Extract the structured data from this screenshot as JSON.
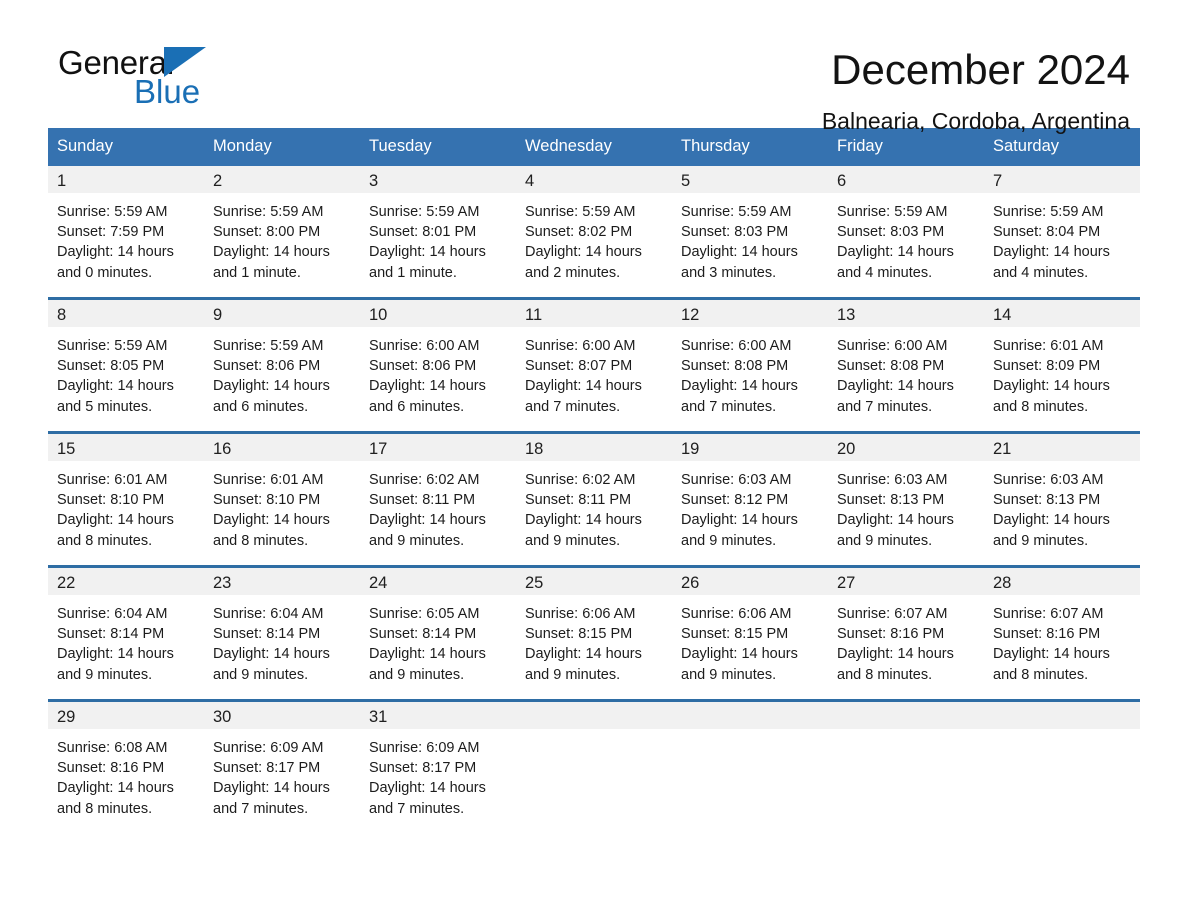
{
  "brand": {
    "name_part1": "General",
    "name_part2": "Blue",
    "triangle_color": "#1a6fb5"
  },
  "header": {
    "title": "December 2024",
    "location": "Balnearia, Cordoba, Argentina"
  },
  "theme": {
    "header_blue": "#3572b0",
    "row_rule_blue": "#2e6da4",
    "daynum_band": "#f1f1f1"
  },
  "weekdays": [
    "Sunday",
    "Monday",
    "Tuesday",
    "Wednesday",
    "Thursday",
    "Friday",
    "Saturday"
  ],
  "labels": {
    "sunrise_prefix": "Sunrise:",
    "sunset_prefix": "Sunset:",
    "daylight_prefix": "Daylight:"
  },
  "weeks": [
    [
      {
        "day": "1",
        "sunrise": "Sunrise: 5:59 AM",
        "sunset": "Sunset: 7:59 PM",
        "daylight_line1": "Daylight: 14 hours",
        "daylight_line2": "and 0 minutes."
      },
      {
        "day": "2",
        "sunrise": "Sunrise: 5:59 AM",
        "sunset": "Sunset: 8:00 PM",
        "daylight_line1": "Daylight: 14 hours",
        "daylight_line2": "and 1 minute."
      },
      {
        "day": "3",
        "sunrise": "Sunrise: 5:59 AM",
        "sunset": "Sunset: 8:01 PM",
        "daylight_line1": "Daylight: 14 hours",
        "daylight_line2": "and 1 minute."
      },
      {
        "day": "4",
        "sunrise": "Sunrise: 5:59 AM",
        "sunset": "Sunset: 8:02 PM",
        "daylight_line1": "Daylight: 14 hours",
        "daylight_line2": "and 2 minutes."
      },
      {
        "day": "5",
        "sunrise": "Sunrise: 5:59 AM",
        "sunset": "Sunset: 8:03 PM",
        "daylight_line1": "Daylight: 14 hours",
        "daylight_line2": "and 3 minutes."
      },
      {
        "day": "6",
        "sunrise": "Sunrise: 5:59 AM",
        "sunset": "Sunset: 8:03 PM",
        "daylight_line1": "Daylight: 14 hours",
        "daylight_line2": "and 4 minutes."
      },
      {
        "day": "7",
        "sunrise": "Sunrise: 5:59 AM",
        "sunset": "Sunset: 8:04 PM",
        "daylight_line1": "Daylight: 14 hours",
        "daylight_line2": "and 4 minutes."
      }
    ],
    [
      {
        "day": "8",
        "sunrise": "Sunrise: 5:59 AM",
        "sunset": "Sunset: 8:05 PM",
        "daylight_line1": "Daylight: 14 hours",
        "daylight_line2": "and 5 minutes."
      },
      {
        "day": "9",
        "sunrise": "Sunrise: 5:59 AM",
        "sunset": "Sunset: 8:06 PM",
        "daylight_line1": "Daylight: 14 hours",
        "daylight_line2": "and 6 minutes."
      },
      {
        "day": "10",
        "sunrise": "Sunrise: 6:00 AM",
        "sunset": "Sunset: 8:06 PM",
        "daylight_line1": "Daylight: 14 hours",
        "daylight_line2": "and 6 minutes."
      },
      {
        "day": "11",
        "sunrise": "Sunrise: 6:00 AM",
        "sunset": "Sunset: 8:07 PM",
        "daylight_line1": "Daylight: 14 hours",
        "daylight_line2": "and 7 minutes."
      },
      {
        "day": "12",
        "sunrise": "Sunrise: 6:00 AM",
        "sunset": "Sunset: 8:08 PM",
        "daylight_line1": "Daylight: 14 hours",
        "daylight_line2": "and 7 minutes."
      },
      {
        "day": "13",
        "sunrise": "Sunrise: 6:00 AM",
        "sunset": "Sunset: 8:08 PM",
        "daylight_line1": "Daylight: 14 hours",
        "daylight_line2": "and 7 minutes."
      },
      {
        "day": "14",
        "sunrise": "Sunrise: 6:01 AM",
        "sunset": "Sunset: 8:09 PM",
        "daylight_line1": "Daylight: 14 hours",
        "daylight_line2": "and 8 minutes."
      }
    ],
    [
      {
        "day": "15",
        "sunrise": "Sunrise: 6:01 AM",
        "sunset": "Sunset: 8:10 PM",
        "daylight_line1": "Daylight: 14 hours",
        "daylight_line2": "and 8 minutes."
      },
      {
        "day": "16",
        "sunrise": "Sunrise: 6:01 AM",
        "sunset": "Sunset: 8:10 PM",
        "daylight_line1": "Daylight: 14 hours",
        "daylight_line2": "and 8 minutes."
      },
      {
        "day": "17",
        "sunrise": "Sunrise: 6:02 AM",
        "sunset": "Sunset: 8:11 PM",
        "daylight_line1": "Daylight: 14 hours",
        "daylight_line2": "and 9 minutes."
      },
      {
        "day": "18",
        "sunrise": "Sunrise: 6:02 AM",
        "sunset": "Sunset: 8:11 PM",
        "daylight_line1": "Daylight: 14 hours",
        "daylight_line2": "and 9 minutes."
      },
      {
        "day": "19",
        "sunrise": "Sunrise: 6:03 AM",
        "sunset": "Sunset: 8:12 PM",
        "daylight_line1": "Daylight: 14 hours",
        "daylight_line2": "and 9 minutes."
      },
      {
        "day": "20",
        "sunrise": "Sunrise: 6:03 AM",
        "sunset": "Sunset: 8:13 PM",
        "daylight_line1": "Daylight: 14 hours",
        "daylight_line2": "and 9 minutes."
      },
      {
        "day": "21",
        "sunrise": "Sunrise: 6:03 AM",
        "sunset": "Sunset: 8:13 PM",
        "daylight_line1": "Daylight: 14 hours",
        "daylight_line2": "and 9 minutes."
      }
    ],
    [
      {
        "day": "22",
        "sunrise": "Sunrise: 6:04 AM",
        "sunset": "Sunset: 8:14 PM",
        "daylight_line1": "Daylight: 14 hours",
        "daylight_line2": "and 9 minutes."
      },
      {
        "day": "23",
        "sunrise": "Sunrise: 6:04 AM",
        "sunset": "Sunset: 8:14 PM",
        "daylight_line1": "Daylight: 14 hours",
        "daylight_line2": "and 9 minutes."
      },
      {
        "day": "24",
        "sunrise": "Sunrise: 6:05 AM",
        "sunset": "Sunset: 8:14 PM",
        "daylight_line1": "Daylight: 14 hours",
        "daylight_line2": "and 9 minutes."
      },
      {
        "day": "25",
        "sunrise": "Sunrise: 6:06 AM",
        "sunset": "Sunset: 8:15 PM",
        "daylight_line1": "Daylight: 14 hours",
        "daylight_line2": "and 9 minutes."
      },
      {
        "day": "26",
        "sunrise": "Sunrise: 6:06 AM",
        "sunset": "Sunset: 8:15 PM",
        "daylight_line1": "Daylight: 14 hours",
        "daylight_line2": "and 9 minutes."
      },
      {
        "day": "27",
        "sunrise": "Sunrise: 6:07 AM",
        "sunset": "Sunset: 8:16 PM",
        "daylight_line1": "Daylight: 14 hours",
        "daylight_line2": "and 8 minutes."
      },
      {
        "day": "28",
        "sunrise": "Sunrise: 6:07 AM",
        "sunset": "Sunset: 8:16 PM",
        "daylight_line1": "Daylight: 14 hours",
        "daylight_line2": "and 8 minutes."
      }
    ],
    [
      {
        "day": "29",
        "sunrise": "Sunrise: 6:08 AM",
        "sunset": "Sunset: 8:16 PM",
        "daylight_line1": "Daylight: 14 hours",
        "daylight_line2": "and 8 minutes."
      },
      {
        "day": "30",
        "sunrise": "Sunrise: 6:09 AM",
        "sunset": "Sunset: 8:17 PM",
        "daylight_line1": "Daylight: 14 hours",
        "daylight_line2": "and 7 minutes."
      },
      {
        "day": "31",
        "sunrise": "Sunrise: 6:09 AM",
        "sunset": "Sunset: 8:17 PM",
        "daylight_line1": "Daylight: 14 hours",
        "daylight_line2": "and 7 minutes."
      },
      {
        "day": "",
        "sunrise": "",
        "sunset": "",
        "daylight_line1": "",
        "daylight_line2": ""
      },
      {
        "day": "",
        "sunrise": "",
        "sunset": "",
        "daylight_line1": "",
        "daylight_line2": ""
      },
      {
        "day": "",
        "sunrise": "",
        "sunset": "",
        "daylight_line1": "",
        "daylight_line2": ""
      },
      {
        "day": "",
        "sunrise": "",
        "sunset": "",
        "daylight_line1": "",
        "daylight_line2": ""
      }
    ]
  ]
}
